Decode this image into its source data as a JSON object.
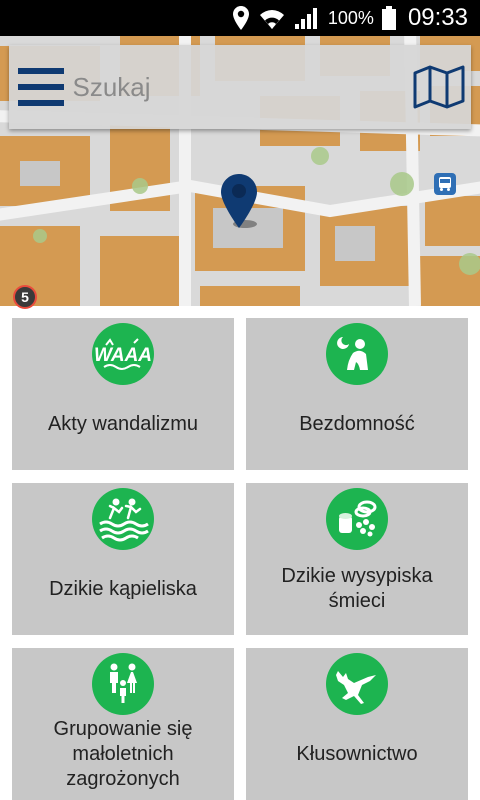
{
  "status_bar": {
    "battery": "100%",
    "time": "09:33"
  },
  "search": {
    "placeholder": "Szukaj"
  },
  "map": {
    "badge": "5"
  },
  "colors": {
    "tile_bg": "#c7c7c7",
    "icon_green": "#1db450",
    "accent_blue": "#0f3a72"
  },
  "categories": [
    {
      "label": "Akty wandalizmu",
      "icon": "vandalism-icon"
    },
    {
      "label": "Bezdomność",
      "icon": "homelessness-icon"
    },
    {
      "label": "Dzikie kąpieliska",
      "icon": "wild-swimming-icon"
    },
    {
      "label": "Dzikie wysypiska śmieci",
      "icon": "illegal-dump-icon"
    },
    {
      "label": "Grupowanie się małoletnich zagrożonych",
      "icon": "minors-gathering-icon"
    },
    {
      "label": "Kłusownictwo",
      "icon": "poaching-icon"
    }
  ]
}
